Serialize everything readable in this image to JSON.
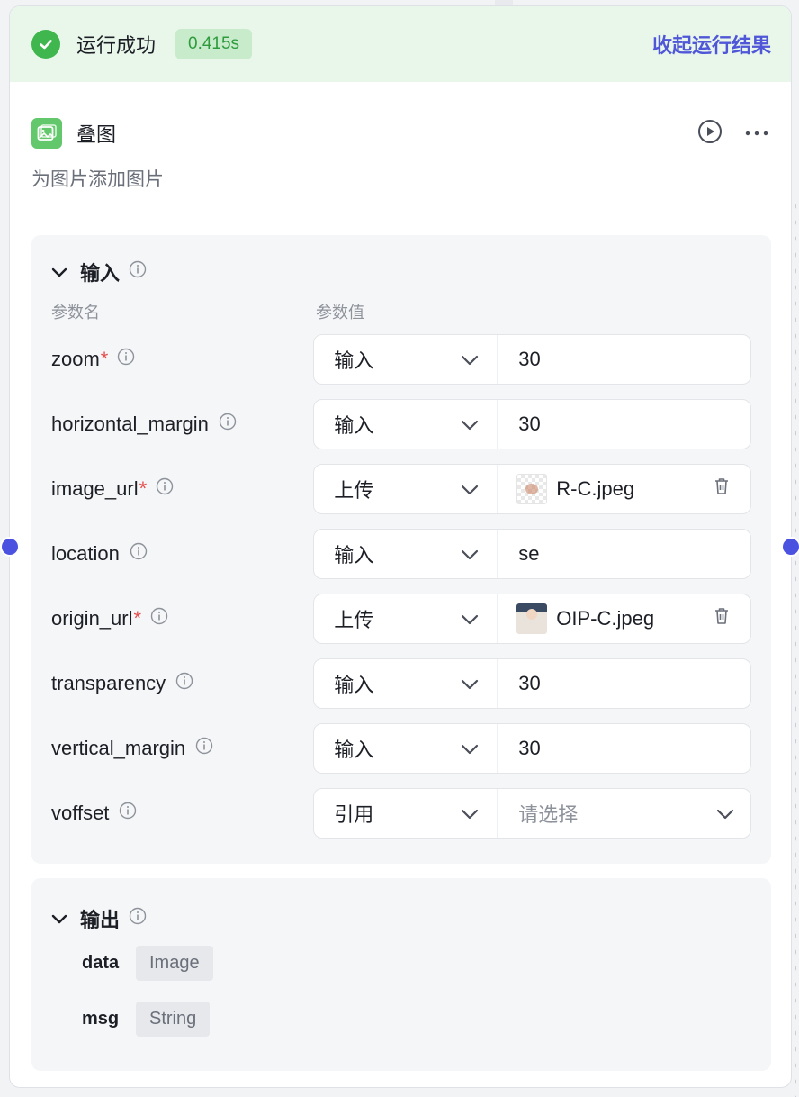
{
  "run": {
    "status": "运行成功",
    "duration": "0.415s",
    "collapse_label": "收起运行结果"
  },
  "node": {
    "title": "叠图",
    "description": "为图片添加图片"
  },
  "input_section": {
    "title": "输入",
    "col_name": "参数名",
    "col_value": "参数值",
    "params": [
      {
        "name": "zoom",
        "required": "*",
        "mode": "输入",
        "value": "30"
      },
      {
        "name": "horizontal_margin",
        "required": "",
        "mode": "输入",
        "value": "30"
      },
      {
        "name": "image_url",
        "required": "*",
        "mode": "上传",
        "value": "R-C.jpeg"
      },
      {
        "name": "location",
        "required": "",
        "mode": "输入",
        "value": "se"
      },
      {
        "name": "origin_url",
        "required": "*",
        "mode": "上传",
        "value": "OIP-C.jpeg"
      },
      {
        "name": "transparency",
        "required": "",
        "mode": "输入",
        "value": "30"
      },
      {
        "name": "vertical_margin",
        "required": "",
        "mode": "输入",
        "value": "30"
      },
      {
        "name": "voffset",
        "required": "",
        "mode": "引用",
        "value": "请选择"
      }
    ]
  },
  "output_section": {
    "title": "输出",
    "items": [
      {
        "name": "data",
        "type": "Image"
      },
      {
        "name": "msg",
        "type": "String"
      }
    ]
  },
  "colors": {
    "accent": "#4f57d8",
    "success": "#3fb74e",
    "required": "#e34d4d",
    "port": "#4c52e0"
  }
}
